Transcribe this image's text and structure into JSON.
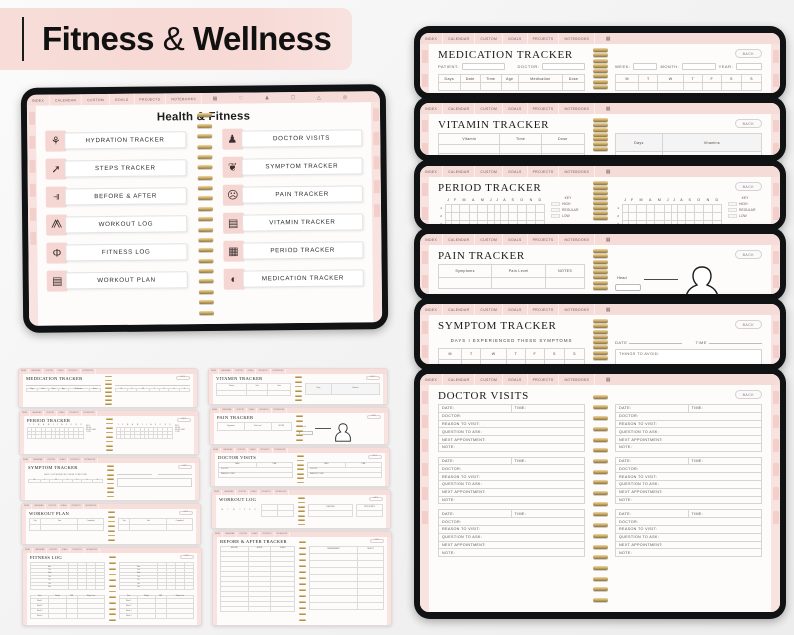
{
  "banner": {
    "title_main": "Fitness",
    "amp": "&",
    "title_sub": "Wellness"
  },
  "nav": {
    "tabs": [
      "INDEX",
      "CALENDAR",
      "CUSTOM",
      "GOALS",
      "PROJECTS",
      "NOTEBOOKS"
    ],
    "icons": [
      "grid-icon",
      "heart-icon",
      "person-icon",
      "camera-icon",
      "user-icon",
      "settings-icon"
    ]
  },
  "index_page": {
    "title": "Health & Fitness",
    "left_items": [
      {
        "label": "HYDRATION TRACKER",
        "icon": "water-bottle-icon",
        "glyph": "☕"
      },
      {
        "label": "STEPS TRACKER",
        "icon": "shoe-icon",
        "glyph": "⬈"
      },
      {
        "label": "BEFORE & AFTER",
        "icon": "mirror-icon",
        "glyph": "⫫"
      },
      {
        "label": "WORKOUT LOG",
        "icon": "dumbbell-icon",
        "glyph": "⚫"
      },
      {
        "label": "FITNESS LOG",
        "icon": "muscle-arm-icon",
        "glyph": "Θ"
      },
      {
        "label": "WORKOUT PLAN",
        "icon": "clipboard-icon",
        "glyph": "☷"
      }
    ],
    "right_items": [
      {
        "label": "DOCTOR VISITS",
        "icon": "doctor-icon",
        "glyph": "♟"
      },
      {
        "label": "SYMPTOM TRACKER",
        "icon": "sneeze-icon",
        "glyph": "❦"
      },
      {
        "label": "PAIN TRACKER",
        "icon": "headache-icon",
        "glyph": "☺"
      },
      {
        "label": "VITAMIN TRACKER",
        "icon": "pill-bottle-icon",
        "glyph": "▤"
      },
      {
        "label": "PERIOD TRACKER",
        "icon": "calendar-icon",
        "glyph": "☷"
      },
      {
        "label": "MEDICATION TRACKER",
        "icon": "capsule-icon",
        "glyph": "◐"
      }
    ]
  },
  "back_label": "BACK",
  "cards": {
    "medication": {
      "title": "MEDICATION TRACKER",
      "fields_left": [
        "PATIENT:",
        "DOCTOR:"
      ],
      "fields_right": [
        "WEEK:",
        "MONTH:",
        "YEAR:"
      ],
      "table_headers": [
        "Days",
        "Date",
        "Time",
        "Age",
        "Medication",
        "Dose"
      ],
      "week_headers": [
        "M",
        "T",
        "W",
        "T",
        "F",
        "S",
        "S"
      ]
    },
    "vitamin": {
      "title": "VITAMIN TRACKER",
      "left_headers": [
        "Vitamin",
        "Time",
        "Dose"
      ],
      "right_headers": [
        "Days",
        "Vitamins"
      ]
    },
    "period": {
      "title": "PERIOD TRACKER",
      "months": [
        "J",
        "F",
        "M",
        "A",
        "M",
        "J",
        "J",
        "A",
        "S",
        "O",
        "N",
        "D"
      ],
      "rows": [
        "1",
        "2",
        "3",
        "4"
      ],
      "key_title": "KEY",
      "key_items": [
        "HIGH",
        "REGULAR",
        "LOW"
      ]
    },
    "pain": {
      "title": "PAIN TRACKER",
      "headers": [
        "Symptoms",
        "Pain Level",
        "NOTES"
      ],
      "body_label": "Head"
    },
    "symptom": {
      "title": "SYMPTOM TRACKER",
      "subtitle": "DAYS I EXPERIENCED THESE SYMPTOMS",
      "day_headers": [
        "M",
        "T",
        "W",
        "T",
        "F",
        "S",
        "S"
      ],
      "date_label": "DATE",
      "time_label": "TIME",
      "avoid_label": "THINGS TO AVOID:"
    },
    "doctor": {
      "title": "DOCTOR VISITS",
      "date_label": "DATE:",
      "time_label": "TIME:",
      "rows": [
        "DOCTOR:",
        "REASON TO VISIT:",
        "QUESTION TO ASK:",
        "NEXT APPOINTMENT:",
        "NOTE:"
      ]
    }
  },
  "thumbs_left": [
    {
      "title": "MEDICATION TRACKER",
      "kind": "medication"
    },
    {
      "title": "PERIOD TRACKER",
      "kind": "period"
    },
    {
      "title": "SYMPTOM TRACKER",
      "kind": "symptom"
    },
    {
      "title": "WORKOUT PLAN",
      "kind": "workout-plan"
    },
    {
      "title": "FITNESS LOG",
      "kind": "fitness-log"
    }
  ],
  "thumbs_mid": [
    {
      "title": "VITAMIN TRACKER",
      "kind": "vitamin"
    },
    {
      "title": "PAIN TRACKER",
      "kind": "pain"
    },
    {
      "title": "DOCTOR VISITS",
      "kind": "doctor"
    },
    {
      "title": "WORKOUT LOG",
      "kind": "workout-log"
    },
    {
      "title": "BEFORE & AFTER TRACKER",
      "kind": "before-after"
    }
  ],
  "thumb_tables": {
    "workout_plan_left": [
      "Day",
      "Time",
      "Completed"
    ],
    "workout_plan_right": [
      "Day",
      "Task",
      "Completed"
    ],
    "fitness_log_days": [
      "Mon",
      "Tue",
      "Wed",
      "Thu",
      "Fri",
      "Sat",
      "Sun"
    ],
    "fitness_log_weeks": [
      "Week 1",
      "Week 2",
      "Week 3",
      "Week 4"
    ],
    "fitness_log_cols": [
      "Date",
      "Weight",
      "BMI",
      "Weight Lost"
    ],
    "before_after_left": [
      "BEFORE",
      "AFTER",
      "GOALS"
    ],
    "before_after_right": [
      "MEASUREMENT",
      "RESULT"
    ],
    "workout_log_right": [
      "EXERCISE",
      "SETS & REPS"
    ]
  },
  "colors": {
    "accent_pink": "#f6d6d2",
    "banner_pink": "#f7dcd8",
    "frame_black": "#111214",
    "paper": "#fdfcfb",
    "spiral_gold": "#c9a963"
  }
}
